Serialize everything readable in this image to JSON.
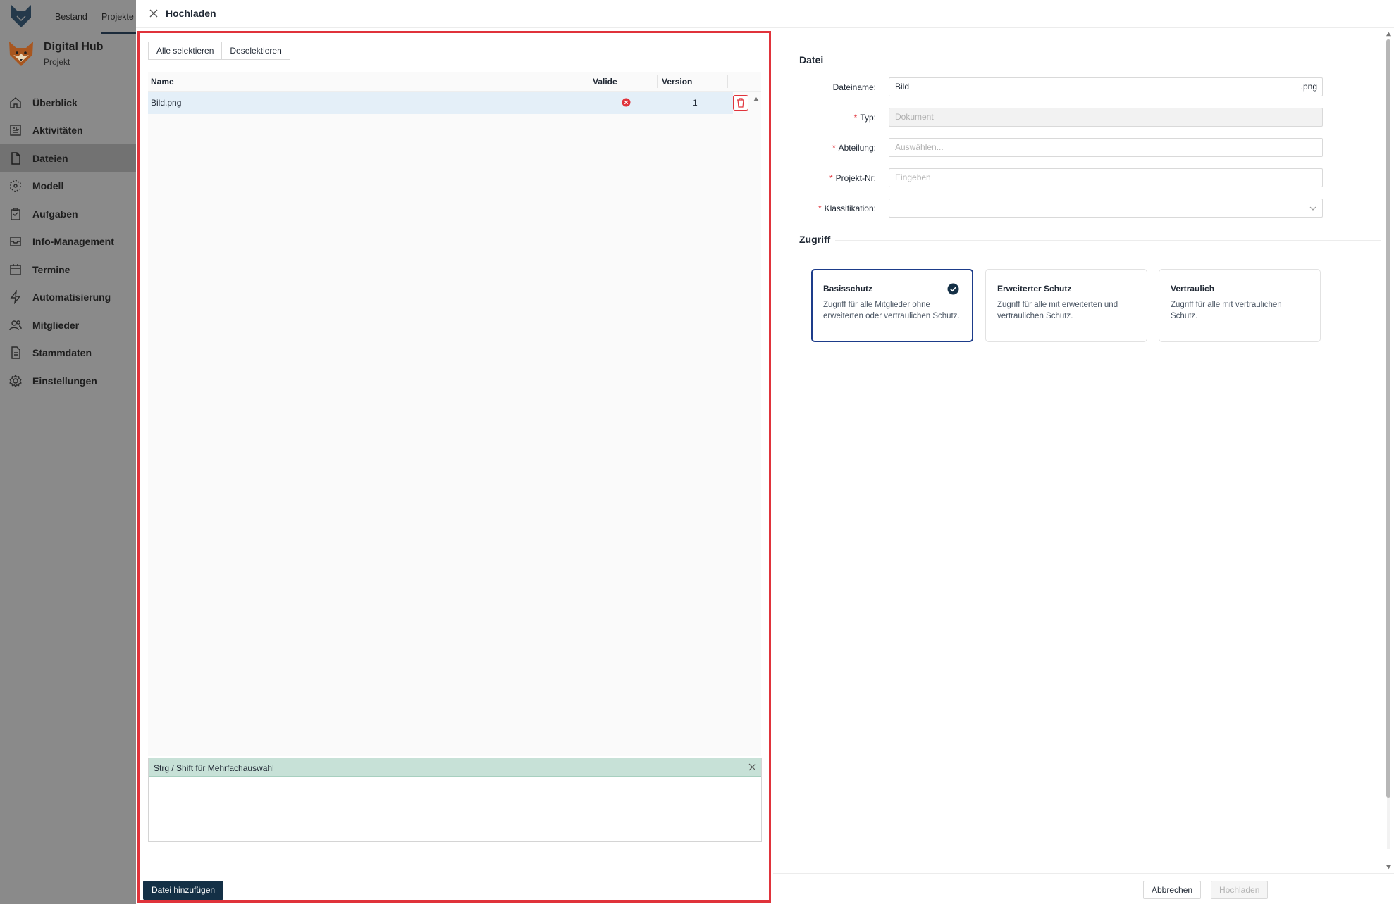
{
  "topnav": {
    "tabs": [
      "Bestand",
      "Projekte"
    ],
    "active": "Projekte"
  },
  "project": {
    "name": "Digital Hub",
    "subtitle": "Projekt"
  },
  "sidebar": {
    "items": [
      {
        "label": "Überblick",
        "icon": "home-icon"
      },
      {
        "label": "Aktivitäten",
        "icon": "activity-icon"
      },
      {
        "label": "Dateien",
        "icon": "file-icon",
        "active": true
      },
      {
        "label": "Modell",
        "icon": "model-icon"
      },
      {
        "label": "Aufgaben",
        "icon": "tasks-icon"
      },
      {
        "label": "Info-Management",
        "icon": "inbox-icon"
      },
      {
        "label": "Termine",
        "icon": "calendar-icon"
      },
      {
        "label": "Automatisierung",
        "icon": "lightning-icon"
      },
      {
        "label": "Mitglieder",
        "icon": "users-icon"
      },
      {
        "label": "Stammdaten",
        "icon": "document-icon"
      },
      {
        "label": "Einstellungen",
        "icon": "gear-icon"
      }
    ]
  },
  "modal": {
    "title": "Hochladen",
    "select_all": "Alle selektieren",
    "deselect": "Deselektieren",
    "table": {
      "headers": [
        "Name",
        "Valide",
        "Version"
      ],
      "rows": [
        {
          "name": "Bild.png",
          "valid": false,
          "version": "1"
        }
      ]
    },
    "info": "Strg / Shift für Mehrfachauswahl",
    "add_file": "Datei hinzufügen"
  },
  "form": {
    "section_file": "Datei",
    "fields": {
      "filename": {
        "label": "Dateiname",
        "value": "Bild",
        "suffix": ".png"
      },
      "type": {
        "label": "Typ",
        "placeholder": "Dokument"
      },
      "department": {
        "label": "Abteilung",
        "placeholder": "Auswählen..."
      },
      "project_no": {
        "label": "Projekt-Nr",
        "placeholder": "Eingeben"
      },
      "classification": {
        "label": "Klassifikation",
        "value": ""
      }
    },
    "section_access": "Zugriff",
    "access_options": [
      {
        "title": "Basisschutz",
        "desc": "Zugriff für alle Mitglieder ohne erweiterten oder vertraulichen Schutz.",
        "selected": true
      },
      {
        "title": "Erweiterter Schutz",
        "desc": "Zugriff für alle mit erweiterten und vertraulichen Schutz.",
        "selected": false
      },
      {
        "title": "Vertraulich",
        "desc": "Zugriff für alle mit vertraulichen Schutz.",
        "selected": false
      }
    ]
  },
  "footer": {
    "cancel": "Abbrechen",
    "upload": "Hochladen"
  },
  "colors": {
    "primary": "#143046",
    "highlight": "#e0333b",
    "selected_row": "#e4eff8",
    "info_bg": "#c7e1d7",
    "card_selected": "#1d3c8a"
  }
}
